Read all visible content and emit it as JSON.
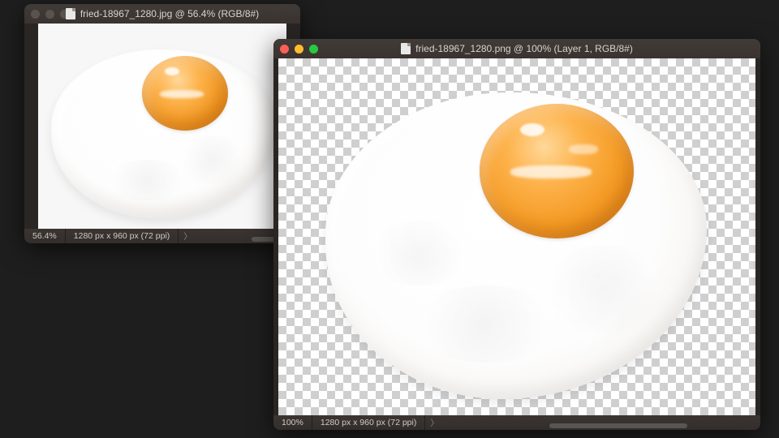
{
  "window_back": {
    "title": "fried-18967_1280.jpg @ 56.4% (RGB/8#)",
    "zoom": "56.4%",
    "dimensions": "1280 px x 960 px (72 ppi)"
  },
  "window_front": {
    "title": "fried-18967_1280.png @ 100% (Layer 1, RGB/8#)",
    "zoom": "100%",
    "dimensions": "1280 px x 960 px (72 ppi)"
  }
}
